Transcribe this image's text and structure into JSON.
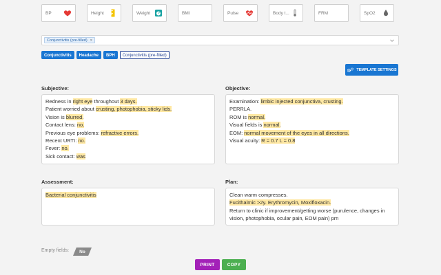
{
  "vitals": [
    {
      "label": "BP",
      "icon": "heart-icon"
    },
    {
      "label": "Height",
      "icon": "ruler-icon"
    },
    {
      "label": "Weight",
      "icon": "scale-icon"
    },
    {
      "label": "BMI",
      "icon": ""
    },
    {
      "label": "Pulse",
      "icon": "heartbeat-icon"
    },
    {
      "label": "Body t...",
      "icon": "thermometer-icon"
    },
    {
      "label": "FRM",
      "icon": ""
    },
    {
      "label": "SpO2",
      "icon": "drop-icon"
    }
  ],
  "template_select": {
    "chip": "Conjunctivitis (pre-filled)",
    "remove": "×"
  },
  "tags": [
    "Conjunctivitis",
    "Headache",
    "BPH",
    "Conjunctivitis (pre-filled)"
  ],
  "template_settings_label": "TEMPLATE SETTINGS",
  "subjective": {
    "label": "Subjective:",
    "lines": [
      [
        {
          "t": "Redness in "
        },
        {
          "t": "right eye",
          "h": true
        },
        {
          "t": " throughout "
        },
        {
          "t": "3 days.",
          "h": true
        }
      ],
      [
        {
          "t": "Patient worried about "
        },
        {
          "t": "crusting, photophobia, sticky lids.",
          "h": true
        }
      ],
      [
        {
          "t": "Vision is "
        },
        {
          "t": "blurred.",
          "h": true
        }
      ],
      [
        {
          "t": "Contact lens: "
        },
        {
          "t": "no.",
          "h": true
        }
      ],
      [
        {
          "t": "Previous eye problems: "
        },
        {
          "t": "refractive errors.",
          "h": true
        }
      ],
      [
        {
          "t": "Recent URTI: "
        },
        {
          "t": "no.",
          "h": true
        }
      ],
      [
        {
          "t": "Fever: "
        },
        {
          "t": "no.",
          "h": true
        }
      ],
      [
        {
          "t": "Sick contact: "
        },
        {
          "t": "was",
          "h": true
        }
      ]
    ]
  },
  "objective": {
    "label": "Objective:",
    "lines": [
      [
        {
          "t": "Examination: "
        },
        {
          "t": "limbic injected conjunctiva, crusting.",
          "h": true
        }
      ],
      [
        {
          "t": "PERRLA."
        }
      ],
      [
        {
          "t": "ROM is "
        },
        {
          "t": "normal.",
          "h": true
        }
      ],
      [
        {
          "t": "Visual fields is "
        },
        {
          "t": "normal.",
          "h": true
        }
      ],
      [
        {
          "t": "EOM: "
        },
        {
          "t": "normal movement of the eyes in all directions.",
          "h": true
        }
      ],
      [
        {
          "t": "Visual acuity: "
        },
        {
          "t": "R = 0.7 L = 0.8",
          "h": true
        }
      ]
    ]
  },
  "assessment": {
    "label": "Assessment:",
    "lines": [
      [
        {
          "t": "Bacterial conjunctivitis",
          "h": true
        }
      ]
    ]
  },
  "plan": {
    "label": "Plan:",
    "lines": [
      [
        {
          "t": "Clean warm compresses."
        }
      ],
      [
        {
          "t": "Fucithalmic >2y. Erythromycin, Moxifloxacin.",
          "h": true
        }
      ],
      [
        {
          "t": "Return to clinic if improvement/getting worse (purulence, changes in vision, photophobia, ocular pain, EOM pain) prn"
        }
      ]
    ]
  },
  "empty_fields": {
    "label": "Empty fields:",
    "value": "No"
  },
  "buttons": {
    "print": "PRINT",
    "copy": "COPY"
  },
  "colors": {
    "primary": "#1976d2",
    "print": "#a321b8",
    "copy": "#4caf50",
    "highlight": "#ffe8a3",
    "heart": "#e53935",
    "ruler": "#f4c400",
    "scale": "#1aa3a3"
  }
}
